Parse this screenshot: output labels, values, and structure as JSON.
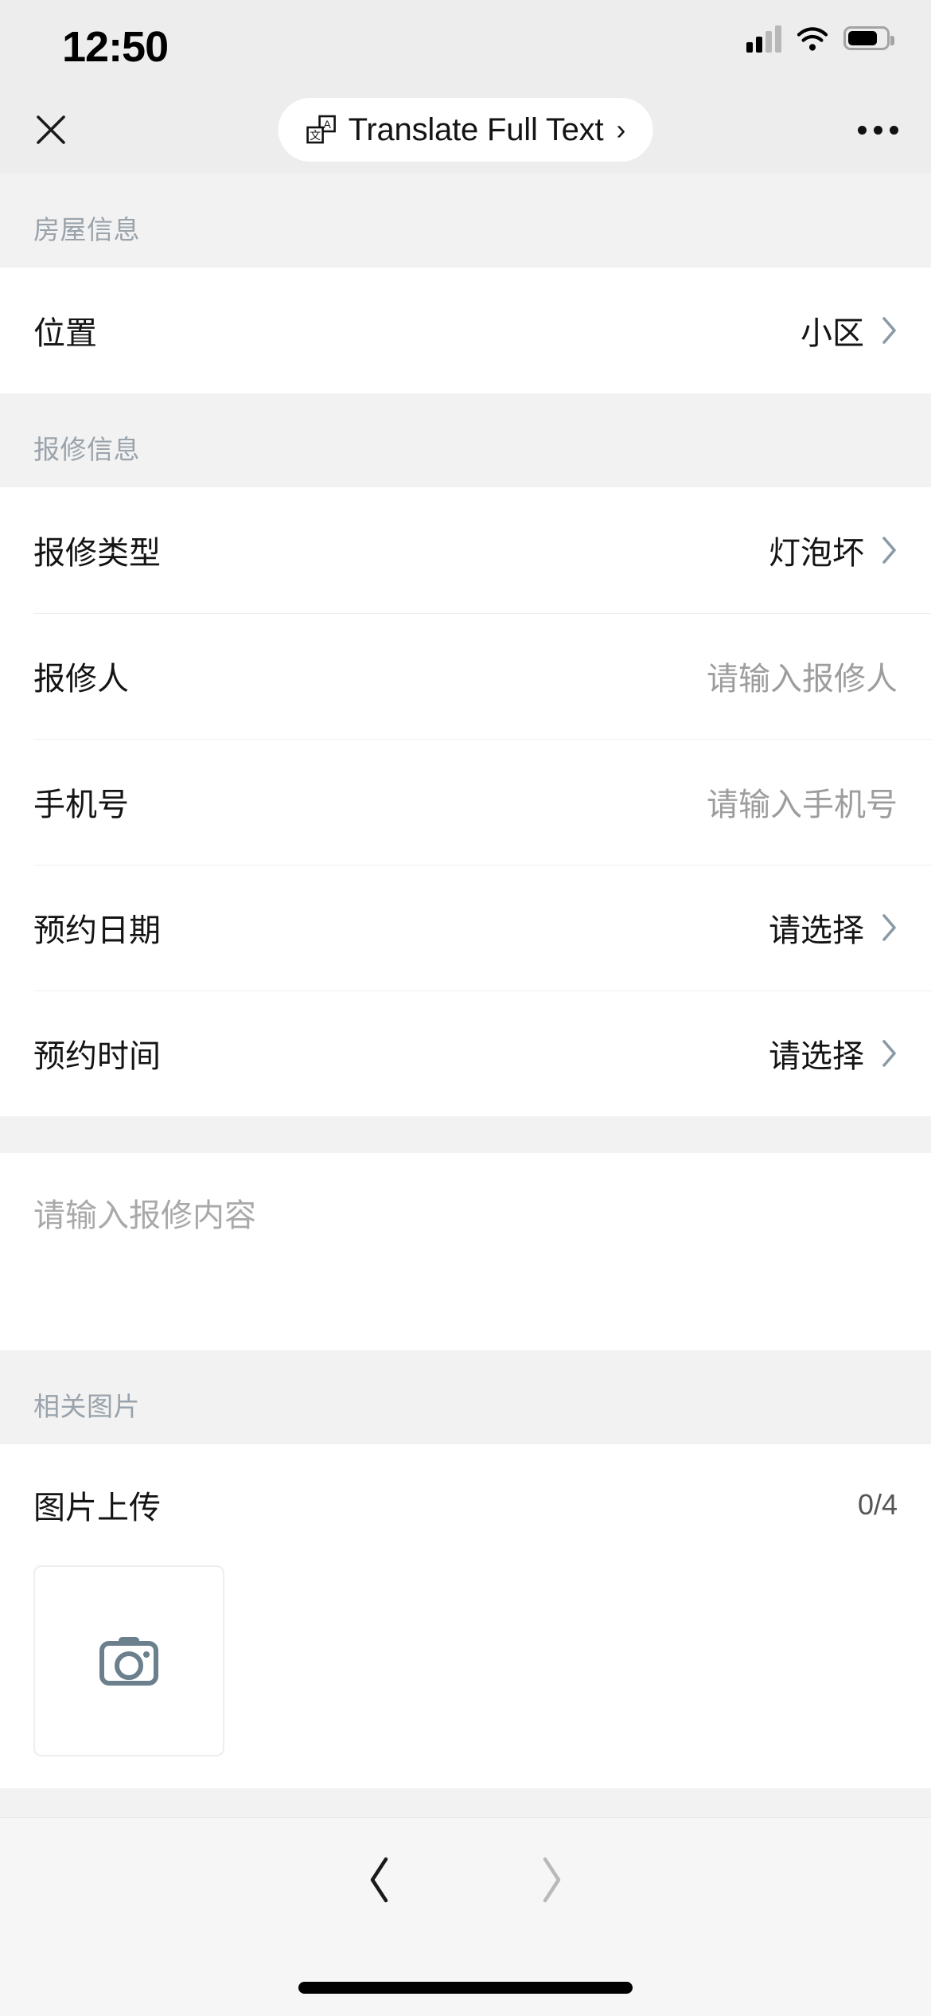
{
  "status_bar": {
    "time": "12:50",
    "signal_icon": "cellular-signal-icon",
    "wifi_icon": "wifi-icon",
    "battery_icon": "battery-icon"
  },
  "nav_bar": {
    "close_icon": "close-icon",
    "translate_icon": "translate-icon",
    "translate_label": "Translate Full Text",
    "translate_caret": "›",
    "more_icon": "more-options-icon"
  },
  "sections": [
    {
      "header": "房屋信息",
      "rows": [
        {
          "label": "位置",
          "value": "小区",
          "is_placeholder": false,
          "chevron": true
        }
      ]
    },
    {
      "header": "报修信息",
      "rows": [
        {
          "label": "报修类型",
          "value": "灯泡坏",
          "is_placeholder": false,
          "chevron": true
        },
        {
          "label": "报修人",
          "value": "请输入报修人",
          "is_placeholder": true,
          "chevron": false
        },
        {
          "label": "手机号",
          "value": "请输入手机号",
          "is_placeholder": true,
          "chevron": false
        },
        {
          "label": "预约日期",
          "value": "请选择",
          "is_placeholder": false,
          "chevron": true
        },
        {
          "label": "预约时间",
          "value": "请选择",
          "is_placeholder": false,
          "chevron": true
        }
      ]
    }
  ],
  "description": {
    "placeholder": "请输入报修内容",
    "value": ""
  },
  "images_section": {
    "header": "相关图片",
    "upload_title": "图片上传",
    "count": "0/4",
    "camera_icon": "camera-icon"
  },
  "bottom_bar": {
    "back_icon": "chevron-left-icon",
    "forward_icon": "chevron-right-icon",
    "home_indicator": "home-indicator"
  },
  "colors": {
    "page_background": "#f2f2f2",
    "chrome_background": "#ededed",
    "card_background": "#ffffff",
    "primary_text": "#141414",
    "muted_text": "#9aa3ab",
    "placeholder_text": "#9d9d9d",
    "chevron": "#8a9ba5",
    "camera_icon": "#6b7f8c"
  }
}
